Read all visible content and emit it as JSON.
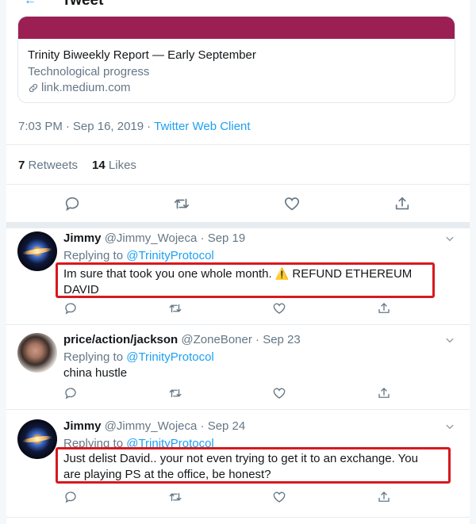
{
  "header": {
    "title": "Tweet"
  },
  "card": {
    "title": "Trinity Biweekly Report — Early September",
    "description": "Technological progress",
    "link": "link.medium.com",
    "image_color": "#9c1f53"
  },
  "tweet_meta": {
    "time": "7:03 PM",
    "date": "Sep 16, 2019",
    "client": "Twitter Web Client"
  },
  "stats": {
    "retweets_count": "7",
    "retweets_label": "Retweets",
    "likes_count": "14",
    "likes_label": "Likes"
  },
  "replies": [
    {
      "name": "Jimmy",
      "handle": "@Jimmy_Wojeca",
      "date": "Sep 19",
      "replying_prefix": "Replying to",
      "replying_to": "@TrinityProtocol",
      "text_before": "Im sure that took you one whole month. ",
      "emoji": "⚠️",
      "text_after": " REFUND ETHEREUM DAVID",
      "avatar": "galaxy"
    },
    {
      "name": "price/action/jackson",
      "handle": "@ZoneBoner",
      "date": "Sep 23",
      "replying_prefix": "Replying to",
      "replying_to": "@TrinityProtocol",
      "text": "china hustle",
      "avatar": "person"
    },
    {
      "name": "Jimmy",
      "handle": "@Jimmy_Wojeca",
      "date": "Sep 24",
      "replying_prefix": "Replying to",
      "replying_to": "@TrinityProtocol",
      "text": "Just delist David.. your not even trying to get it to an exchange. You are playing PS at the office, be honest?",
      "avatar": "galaxy"
    }
  ],
  "colors": {
    "accent": "#1da1f2",
    "secondary_text": "#657786",
    "highlight_box": "#d7191f"
  }
}
